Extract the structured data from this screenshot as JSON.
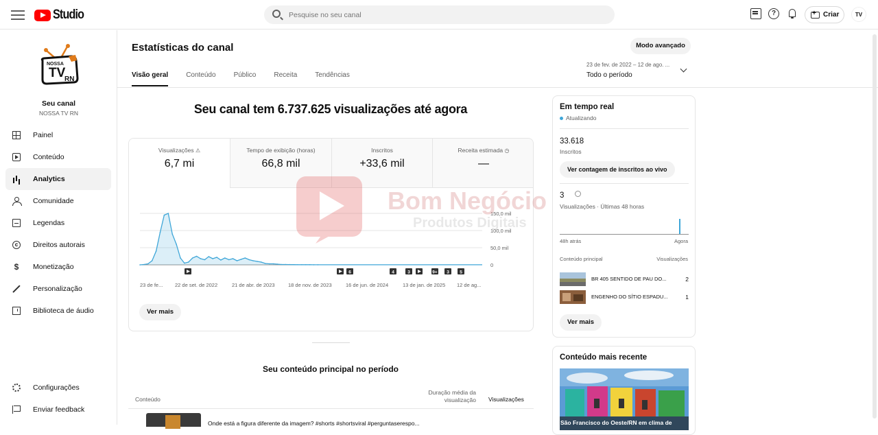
{
  "app": {
    "name": "Studio"
  },
  "search": {
    "placeholder": "Pesquise no seu canal"
  },
  "topbar": {
    "create_label": "Criar",
    "avatar_text": "TV"
  },
  "channel": {
    "logo_line1": "NOSSA",
    "logo_line2": "TV",
    "logo_line3": "RN",
    "title": "Seu canal",
    "name": "NOSSA TV RN"
  },
  "sidebar": {
    "items": [
      {
        "label": "Painel",
        "icon": "dashboard-icon"
      },
      {
        "label": "Conteúdo",
        "icon": "content-icon"
      },
      {
        "label": "Analytics",
        "icon": "analytics-icon",
        "active": true
      },
      {
        "label": "Comunidade",
        "icon": "community-icon"
      },
      {
        "label": "Legendas",
        "icon": "subtitles-icon"
      },
      {
        "label": "Direitos autorais",
        "icon": "copyright-icon"
      },
      {
        "label": "Monetização",
        "icon": "monetization-icon"
      },
      {
        "label": "Personalização",
        "icon": "customization-icon"
      },
      {
        "label": "Biblioteca de áudio",
        "icon": "audio-library-icon"
      }
    ],
    "footer": [
      {
        "label": "Configurações",
        "icon": "settings-icon"
      },
      {
        "label": "Enviar feedback",
        "icon": "feedback-icon"
      }
    ]
  },
  "page": {
    "title": "Estatísticas do canal",
    "advanced_mode": "Modo avançado",
    "tabs": [
      "Visão geral",
      "Conteúdo",
      "Público",
      "Receita",
      "Tendências"
    ],
    "date_range": {
      "range": "23 de fev. de 2022 – 12 de ago. ...",
      "label": "Todo o período"
    }
  },
  "overview": {
    "headline": "Seu canal tem 6.737.625 visualizações até agora",
    "metrics": [
      {
        "label": "Visualizações",
        "value": "6,7 mi"
      },
      {
        "label": "Tempo de exibição (horas)",
        "value": "66,8 mil"
      },
      {
        "label": "Inscritos",
        "value": "+33,6 mil"
      },
      {
        "label": "Receita estimada",
        "value": "—"
      }
    ],
    "see_more": "Ver mais"
  },
  "chart_data": {
    "type": "line",
    "x": [
      "23 de fe...",
      "22 de set. de 2022",
      "21 de abr. de 2023",
      "18 de nov. de 2023",
      "16 de jun. de 2024",
      "13 de jan. de 2025",
      "12 de ag..."
    ],
    "y_ticks": [
      "150,0 mil",
      "100,0 mil",
      "50,0 mil",
      "0"
    ],
    "ylim": [
      0,
      150000
    ],
    "series": [
      {
        "values": [
          0,
          1000,
          3000,
          12000,
          40000,
          95000,
          145000,
          150000,
          90000,
          60000,
          20000,
          5000,
          8000,
          20000,
          25000,
          18000,
          15000,
          24000,
          18000,
          22000,
          14000,
          20000,
          15000,
          18000,
          12000,
          16000,
          20000,
          15000,
          12000,
          10000,
          8000,
          4000,
          3000,
          3000,
          2000,
          1000,
          1000,
          800,
          600,
          500,
          400,
          300,
          300,
          200,
          200
        ]
      }
    ],
    "markers": [
      {
        "type": "video",
        "label": ""
      },
      {
        "type": "video",
        "label": ""
      },
      {
        "type": "count",
        "label": "6"
      },
      {
        "type": "count",
        "label": "4"
      },
      {
        "type": "count",
        "label": "3"
      },
      {
        "type": "video",
        "label": ""
      },
      {
        "type": "count",
        "label": "9+"
      },
      {
        "type": "count",
        "label": "3"
      },
      {
        "type": "count",
        "label": "5"
      }
    ],
    "color": "#3ea6d8"
  },
  "realtime": {
    "title": "Em tempo real",
    "status": "Atualizando",
    "subscribers_value": "33.618",
    "subscribers_label": "Inscritos",
    "live_button": "Ver contagem de inscritos ao vivo",
    "views_value": "3",
    "views_label": "Visualizações · Últimas 48 horas",
    "axis_start": "48h atrás",
    "axis_end": "Agora",
    "list_header_left": "Conteúdo principal",
    "list_header_right": "Visualizações",
    "items": [
      {
        "title": "BR 405 SENTIDO DE PAU DO...",
        "views": "2"
      },
      {
        "title": "ENGENHO DO SÍTIO ESPADU...",
        "views": "1"
      }
    ],
    "see_more": "Ver mais"
  },
  "recent": {
    "title": "Conteúdo mais recente",
    "caption": "São Francisco do Oeste/RN em clima de"
  },
  "top_content": {
    "title": "Seu conteúdo principal no período",
    "col_content": "Conteúdo",
    "col_avg": "Duração média da visualização",
    "col_views": "Visualizações",
    "first_row_title": "Onde está a figura diferente da imagem? #shorts #shortsviral #perguntaserespo..."
  },
  "watermark": {
    "line1": "Bom Negócio",
    "line2": "Produtos Digitais"
  }
}
